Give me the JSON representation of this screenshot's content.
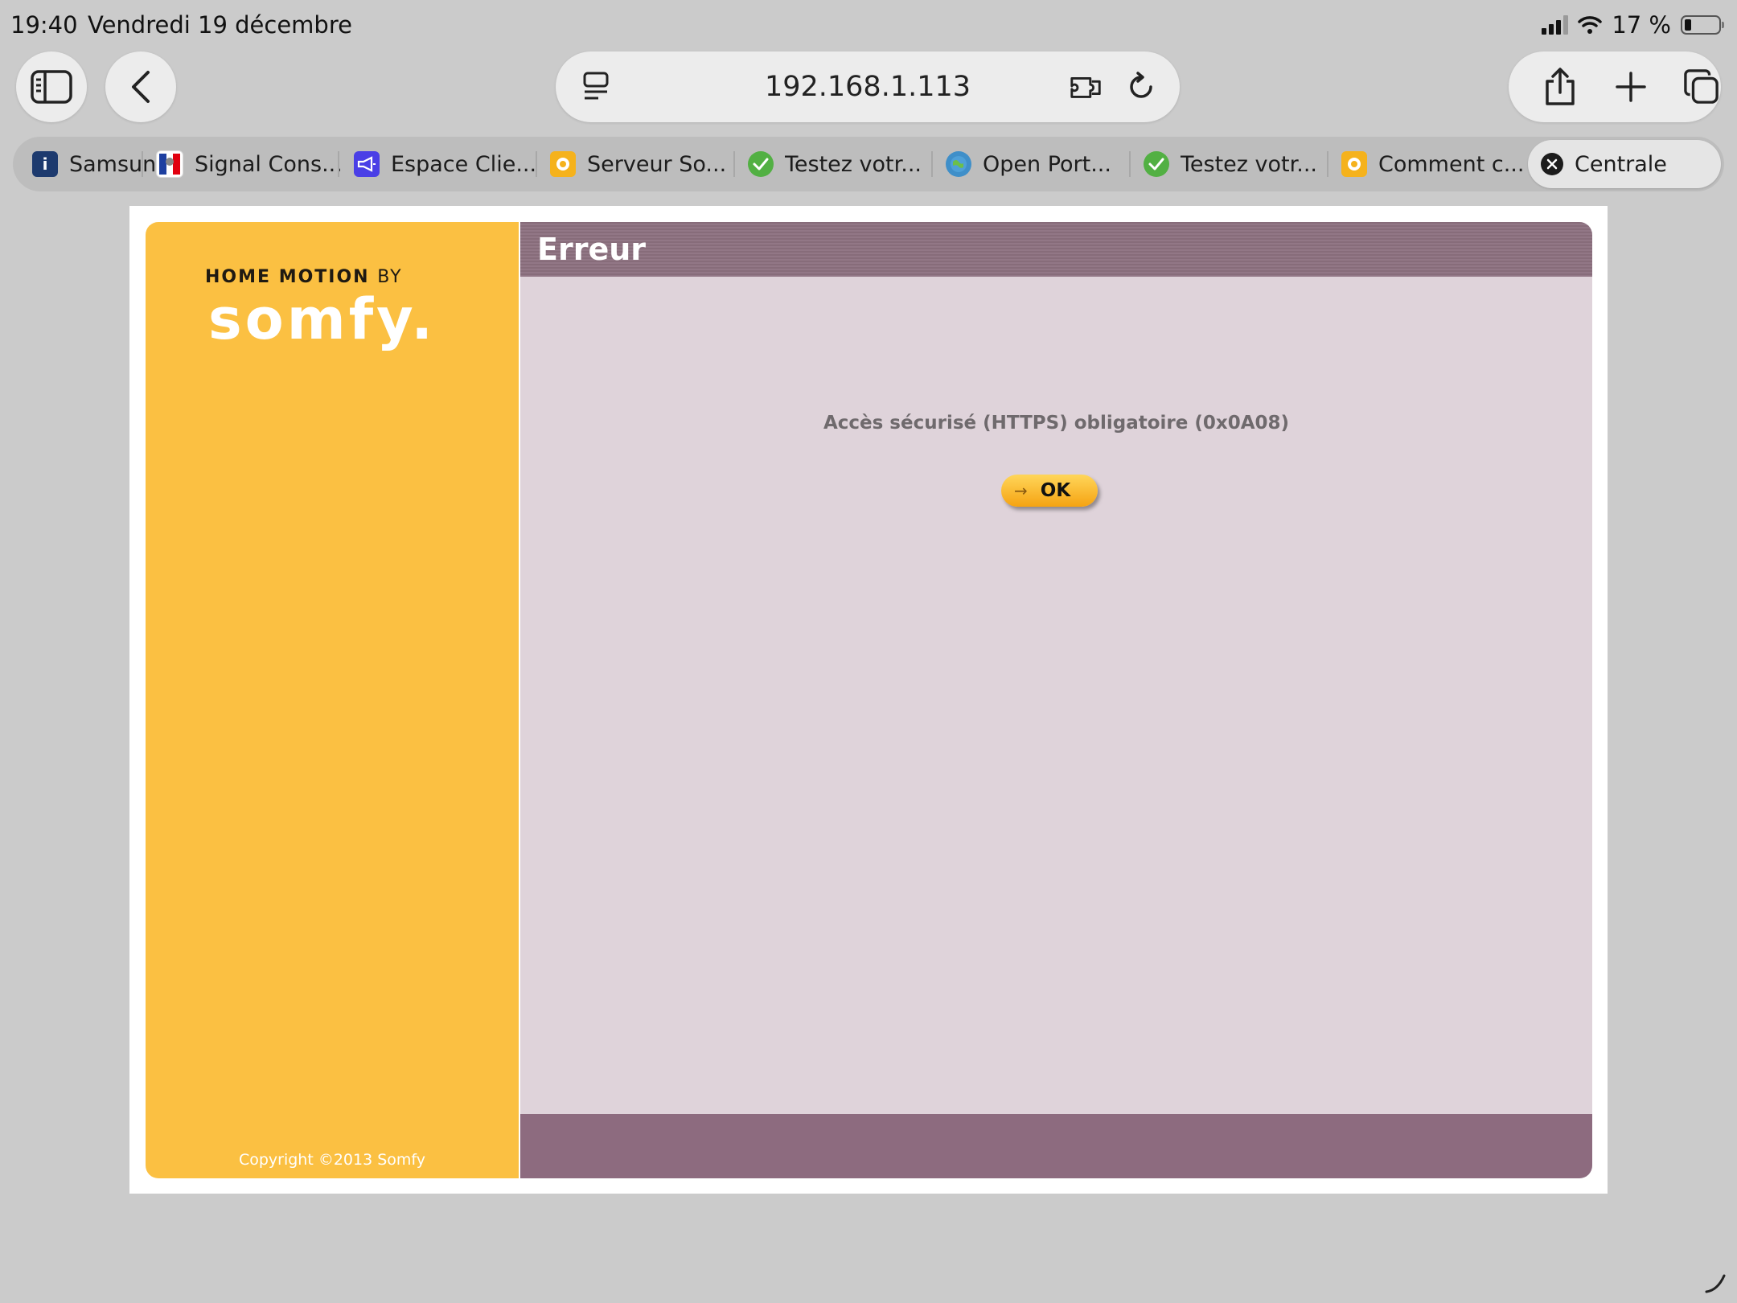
{
  "status_bar": {
    "time": "19:40",
    "date": "Vendredi 19 décembre",
    "battery_percent": "17 %"
  },
  "toolbar": {
    "address": "192.168.1.113"
  },
  "tabs": [
    {
      "label": "Samsung",
      "icon": "samsung-favicon",
      "color": "#1d3a6e"
    },
    {
      "label": "Signal Cons...",
      "icon": "marianne-favicon",
      "color": "#ffffff"
    },
    {
      "label": "Espace Clie...",
      "icon": "megaphone-favicon",
      "color": "#4a3fe6"
    },
    {
      "label": "Serveur So...",
      "icon": "somfy-favicon",
      "color": "#f5b21c"
    },
    {
      "label": "Testez votr...",
      "icon": "check-favicon",
      "color": "#52b043"
    },
    {
      "label": "Open Port...",
      "icon": "globe-favicon",
      "color": "#3f8fc9"
    },
    {
      "label": "Testez votr...",
      "icon": "check-favicon",
      "color": "#52b043"
    },
    {
      "label": "Comment c...",
      "icon": "somfy-favicon",
      "color": "#f5b21c"
    }
  ],
  "active_tab": {
    "label": "Centrale"
  },
  "page": {
    "logo_tagline": "HOME MOTION",
    "logo_by": "BY",
    "logo_wordmark": "somfy.",
    "copyright": "Copyright ©2013 Somfy",
    "title": "Erreur",
    "error_message": "Accès sécurisé (HTTPS) obligatoire (0x0A08)",
    "ok_label": "OK"
  },
  "colors": {
    "somfy_yellow": "#fbc042",
    "header_mauve": "#8c707f",
    "content_bg": "#dfd3da"
  }
}
